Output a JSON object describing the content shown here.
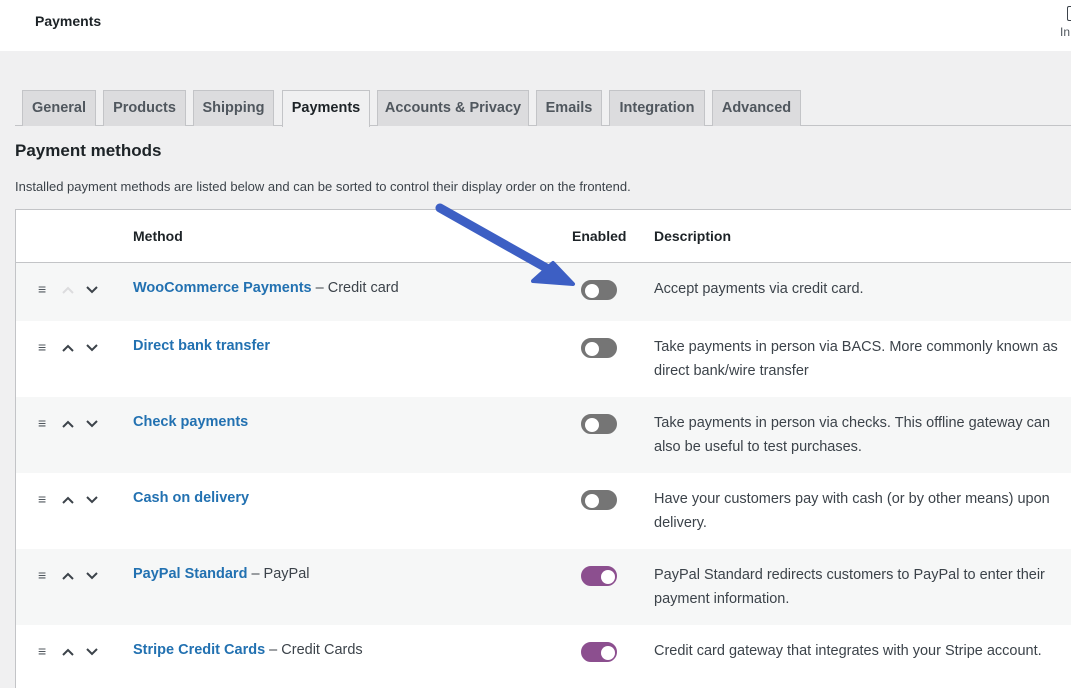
{
  "header": {
    "title": "Payments",
    "inbox_label": "In"
  },
  "tabs": [
    {
      "label": "General"
    },
    {
      "label": "Products"
    },
    {
      "label": "Shipping"
    },
    {
      "label": "Payments"
    },
    {
      "label": "Accounts & Privacy"
    },
    {
      "label": "Emails"
    },
    {
      "label": "Integration"
    },
    {
      "label": "Advanced"
    }
  ],
  "active_tab": "Payments",
  "section": {
    "title": "Payment methods",
    "intro": "Installed payment methods are listed below and can be sorted to control their display order on the frontend."
  },
  "table": {
    "columns": {
      "method": "Method",
      "enabled": "Enabled",
      "description": "Description"
    },
    "rows": [
      {
        "name": "WooCommerce Payments",
        "suffix": "Credit card",
        "enabled": false,
        "desc": "Accept payments via credit card."
      },
      {
        "name": "Direct bank transfer",
        "suffix": "",
        "enabled": false,
        "desc": "Take payments in person via BACS. More commonly known as direct bank/wire transfer"
      },
      {
        "name": "Check payments",
        "suffix": "",
        "enabled": false,
        "desc": "Take payments in person via checks. This offline gateway can also be useful to test purchases."
      },
      {
        "name": "Cash on delivery",
        "suffix": "",
        "enabled": false,
        "desc": "Have your customers pay with cash (or by other means) upon delivery."
      },
      {
        "name": "PayPal Standard",
        "suffix": "PayPal",
        "enabled": true,
        "desc": "PayPal Standard redirects customers to PayPal to enter their payment information."
      },
      {
        "name": "Stripe Credit Cards",
        "suffix": "Credit Cards",
        "enabled": true,
        "desc": "Credit card gateway that integrates with your Stripe account."
      }
    ],
    "separator": "–"
  },
  "colors": {
    "link": "#2271b1",
    "toggle_on": "#8c4f8f",
    "toggle_off": "#757575",
    "annotation_arrow": "#3d5fc4"
  },
  "icons": {
    "handle": "drag-handle-icon",
    "up": "chevron-up-icon",
    "down": "chevron-down-icon",
    "inbox": "inbox-icon"
  }
}
